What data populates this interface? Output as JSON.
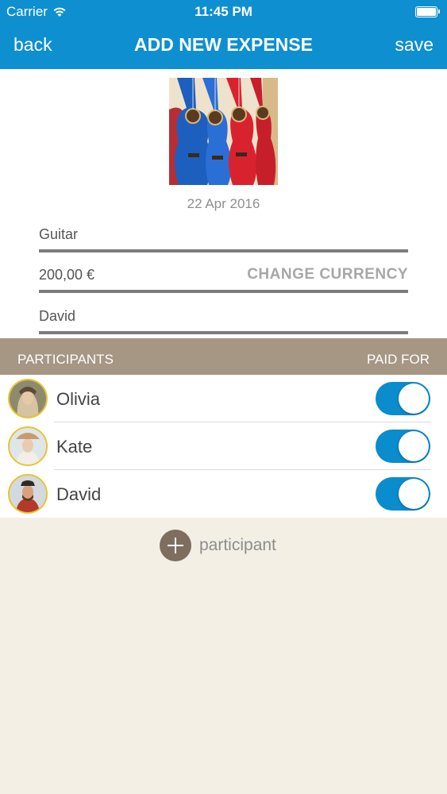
{
  "status": {
    "carrier": "Carrier",
    "time": "11:45 PM"
  },
  "nav": {
    "back": "back",
    "title": "ADD NEW EXPENSE",
    "save": "save"
  },
  "expense": {
    "date": "22 Apr 2016",
    "name": "Guitar",
    "amount": "200,00 €",
    "change_currency": "CHANGE CURRENCY",
    "paid_by": "David"
  },
  "participants": {
    "header_left": "PARTICIPANTS",
    "header_right": "PAID FOR",
    "items": [
      {
        "name": "Olivia",
        "paid_for": true
      },
      {
        "name": "Kate",
        "paid_for": true
      },
      {
        "name": "David",
        "paid_for": true
      }
    ],
    "add_label": "participant"
  },
  "colors": {
    "header": "#0e8fd0",
    "participants_header": "#a69684",
    "toggle_on": "#0a8ccd",
    "avatar_ring": "#e8c52d",
    "background": "#f3efe4"
  }
}
